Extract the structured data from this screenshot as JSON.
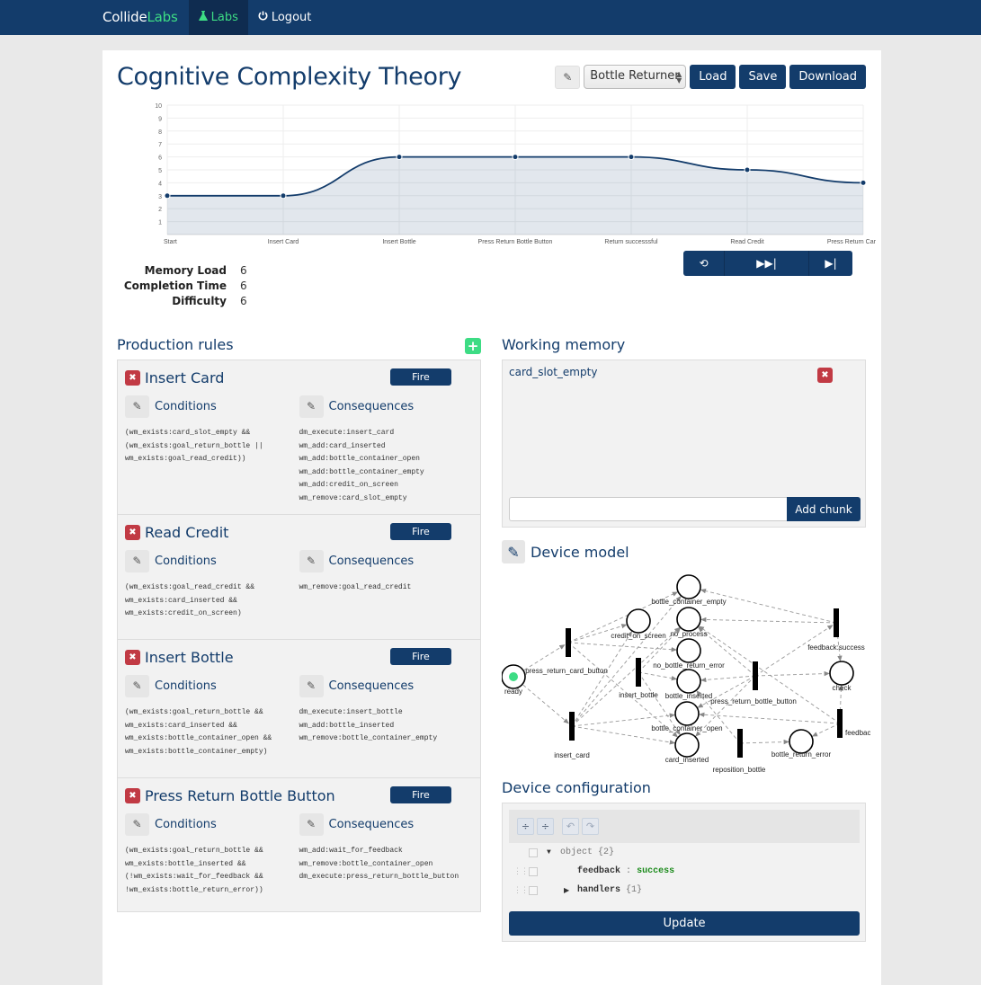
{
  "nav": {
    "brand_main": "Collide",
    "brand_accent": "Labs",
    "items": [
      {
        "label": "Labs",
        "icon": "flask-icon",
        "active": true
      },
      {
        "label": "Logout",
        "icon": "power-icon",
        "active": false
      }
    ]
  },
  "page": {
    "title": "Cognitive Complexity Theory",
    "model_select": "Bottle Returner",
    "load_label": "Load",
    "save_label": "Save",
    "download_label": "Download"
  },
  "chart_data": {
    "type": "line",
    "categories": [
      "Start",
      "Insert Card",
      "Insert Bottle",
      "Press Return Bottle Button",
      "Return successsful",
      "Read Credit",
      "Press Return Card Button"
    ],
    "values": [
      3,
      3,
      6,
      6,
      6,
      5,
      4
    ],
    "ylim": [
      0,
      10
    ],
    "yticks": [
      "1",
      "2",
      "3",
      "4",
      "5",
      "6",
      "7",
      "8",
      "9",
      "10"
    ],
    "title": "",
    "xlabel": "",
    "ylabel": "",
    "grid": true,
    "fill": true,
    "color": "#133c6b"
  },
  "stats": [
    {
      "label": "Memory Load",
      "value": "6"
    },
    {
      "label": "Completion Time",
      "value": "6"
    },
    {
      "label": "Difficulty",
      "value": "6"
    }
  ],
  "stepper": {
    "reset_icon": "reset-icon",
    "run_all_icon": "fast-forward-icon",
    "step_icon": "step-forward-icon"
  },
  "production_rules": {
    "heading": "Production rules",
    "fire_label": "Fire",
    "conditions_label": "Conditions",
    "consequences_label": "Consequences",
    "rules": [
      {
        "name": "Insert Card",
        "conditions": "(wm_exists:card_slot_empty &&\n(wm_exists:goal_return_bottle ||\nwm_exists:goal_read_credit))",
        "consequences": "dm_execute:insert_card\nwm_add:card_inserted\nwm_add:bottle_container_open\nwm_add:bottle_container_empty\nwm_add:credit_on_screen\nwm_remove:card_slot_empty"
      },
      {
        "name": "Read Credit",
        "conditions": "(wm_exists:goal_read_credit &&\nwm_exists:card_inserted &&\nwm_exists:credit_on_screen)",
        "consequences": "wm_remove:goal_read_credit"
      },
      {
        "name": "Insert Bottle",
        "conditions": "(wm_exists:goal_return_bottle &&\nwm_exists:card_inserted &&\nwm_exists:bottle_container_open &&\nwm_exists:bottle_container_empty)",
        "consequences": "dm_execute:insert_bottle\nwm_add:bottle_inserted\nwm_remove:bottle_container_empty"
      },
      {
        "name": "Press Return Bottle Button",
        "conditions": "(wm_exists:goal_return_bottle &&\nwm_exists:bottle_inserted &&\n(!wm_exists:wait_for_feedback &&\n!wm_exists:bottle_return_error))",
        "consequences": "wm_add:wait_for_feedback\nwm_remove:bottle_container_open\ndm_execute:press_return_bottle_button"
      }
    ]
  },
  "working_memory": {
    "heading": "Working memory",
    "items": [
      "card_slot_empty"
    ],
    "input_value": "",
    "add_label": "Add chunk"
  },
  "device_model": {
    "heading": "Device model",
    "places": [
      "ready",
      "credit_on_screen",
      "bottle_container_empty",
      "no_process",
      "no_bottle_return_error",
      "bottle_inserted",
      "bottle_container_open",
      "card_inserted",
      "check",
      "bottle_return_error"
    ],
    "transitions": [
      "press_return_card_button",
      "insert_card",
      "insert_bottle",
      "press_return_bottle_button",
      "feedback:success",
      "feedback:error",
      "reposition_bottle"
    ],
    "marked_place": "ready",
    "token_color": "#3ddc84"
  },
  "device_configuration": {
    "heading": "Device configuration",
    "root_label": "object",
    "root_count": "{2}",
    "fields": [
      {
        "key": "feedback",
        "value": "success"
      },
      {
        "key": "handlers",
        "count": "{1}"
      }
    ],
    "update_label": "Update"
  }
}
